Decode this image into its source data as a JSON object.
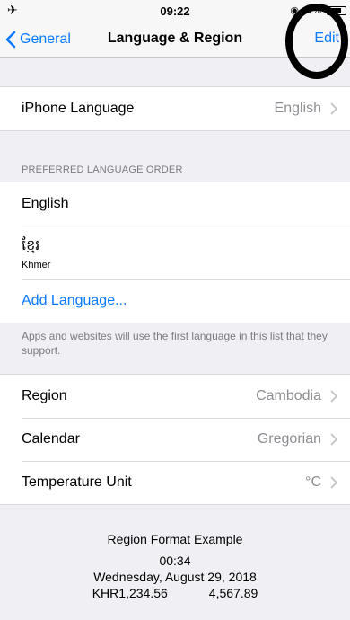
{
  "status_bar": {
    "time": "09:22",
    "right_text": "◉ 41%"
  },
  "nav": {
    "back_label": "General",
    "title": "Language & Region",
    "edit_label": "Edit"
  },
  "iphone_language": {
    "label": "iPhone Language",
    "value": "English"
  },
  "preferred": {
    "header": "PREFERRED LANGUAGE ORDER",
    "items": [
      {
        "label": "English"
      },
      {
        "label": "ខ្មែរ",
        "sublabel": "Khmer"
      }
    ],
    "add_label": "Add Language...",
    "footer": "Apps and websites will use the first language in this list that they support."
  },
  "settings": {
    "region_label": "Region",
    "region_value": "Cambodia",
    "calendar_label": "Calendar",
    "calendar_value": "Gregorian",
    "temp_label": "Temperature Unit",
    "temp_value": "°C"
  },
  "format_example": {
    "title": "Region Format Example",
    "time": "00:34",
    "date": "Wednesday, August 29, 2018",
    "currency": "KHR1,234.56",
    "number": "4,567.89"
  },
  "colors": {
    "accent": "#0a7aff",
    "background": "#efeff4",
    "secondary_text": "#8e8e93"
  }
}
